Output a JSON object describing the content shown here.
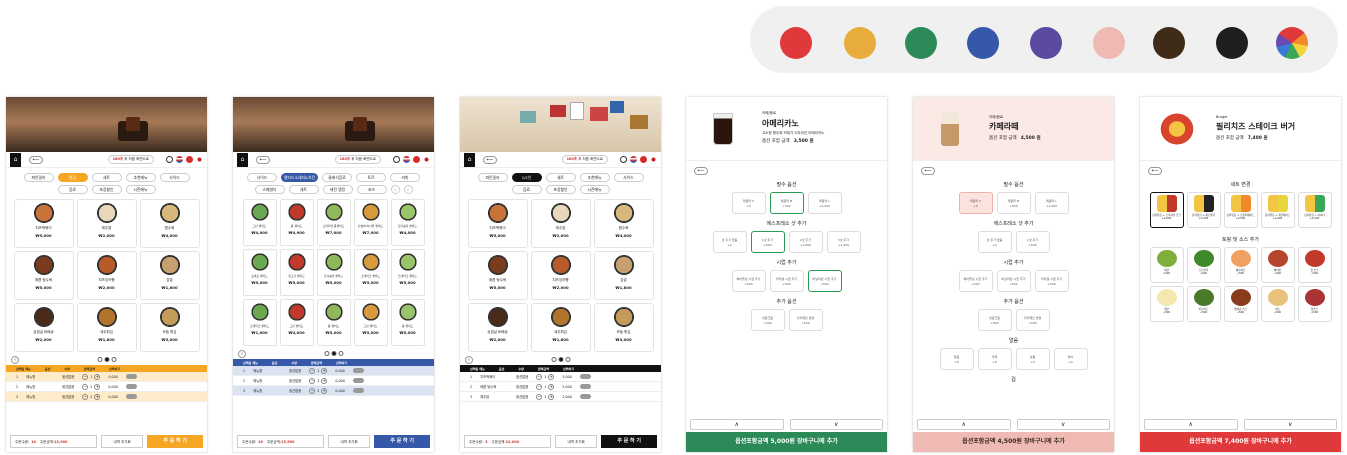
{
  "palette": [
    {
      "name": "red",
      "color": "#e0393b"
    },
    {
      "name": "yellow",
      "color": "#e8ad3c"
    },
    {
      "name": "green",
      "color": "#2b8a57"
    },
    {
      "name": "blue",
      "color": "#3658a8"
    },
    {
      "name": "purple",
      "color": "#5b4aa0"
    },
    {
      "name": "pink",
      "color": "#efb9b4"
    },
    {
      "name": "brown",
      "color": "#3f2c18"
    },
    {
      "name": "black",
      "color": "#1f1f1f"
    },
    {
      "name": "rainbow",
      "color": "multi"
    }
  ],
  "timer": {
    "num": "180초",
    "text": " 후 처음 화면으로"
  },
  "home_icon": "⌂",
  "back_label": "⟵",
  "panel1": {
    "accent": "#f5a623",
    "tabs": [
      "파인밀러",
      "면공",
      "세트",
      "추천메뉴",
      "사이드",
      "음료",
      "포장할인",
      "시즌메뉴"
    ],
    "active_tab": 1,
    "dishes": [
      {
        "name": "치즈떡볶이",
        "price": "₩5,000"
      },
      {
        "name": "제주쌈",
        "price": "₩2,000"
      },
      {
        "name": "짬수육",
        "price": "₩4,000"
      },
      {
        "name": "매콤 탕수육",
        "price": "₩5,000"
      },
      {
        "name": "치즈잉어빵",
        "price": "₩2,000"
      },
      {
        "name": "김밥",
        "price": "₩1,800"
      },
      {
        "name": "삼겹살 바베큐",
        "price": "₩2,000"
      },
      {
        "name": "새우튀김",
        "price": "₩1,800"
      },
      {
        "name": "모둠 튀김",
        "price": "₩3,000"
      }
    ],
    "order_head": [
      "선택된 메뉴",
      "옵션",
      "수량",
      "판매금액",
      "선택하기"
    ],
    "orders": [
      {
        "no": "1",
        "name": "매뉴명",
        "opt": "옵션없음",
        "qty": "1",
        "price": "0,000"
      },
      {
        "no": "2",
        "name": "매뉴명",
        "opt": "옵션없음",
        "qty": "2",
        "price": "0,000"
      },
      {
        "no": "3",
        "name": "매뉴명",
        "opt": "옵션없음",
        "qty": "2",
        "price": "0,000"
      }
    ],
    "count_label": "주문수량:",
    "count": "10",
    "amount_label": "주문금액:",
    "amount": "13,900",
    "reset": "내역 초기화",
    "order": "주 문 하 기"
  },
  "panel2": {
    "accent": "#3658a8",
    "tabs": [
      "사이드",
      "멜티드소세지&치킨",
      "클래식음료",
      "토르",
      "커피",
      "스페셜티",
      "세트",
      "레전 랭킹",
      "코즈"
    ],
    "active_tab": 1,
    "dishes": [
      {
        "name": "그린 샐러드",
        "price": "₩4,000"
      },
      {
        "name": "콥 샐러드",
        "price": "₩4,900"
      },
      {
        "name": "오리지널 콥샐러드",
        "price": "₩7,000"
      },
      {
        "name": "단호박 어니언 샐러드",
        "price": "₩7,000"
      },
      {
        "name": "닭가슴살 샐러드",
        "price": "₩4,000"
      },
      {
        "name": "토마토 샐러드",
        "price": "₩5,000"
      },
      {
        "name": "불고기 샐러드",
        "price": "₩5,000"
      },
      {
        "name": "닭가슴살 샐러드",
        "price": "₩5,000"
      },
      {
        "name": "스테이크 샐러드",
        "price": "₩5,000"
      },
      {
        "name": "스테이크 샐러드",
        "price": "₩5,000"
      },
      {
        "name": "스테이크 샐러드",
        "price": "₩1,000"
      },
      {
        "name": "그린 샐러드",
        "price": "₩4,000"
      },
      {
        "name": "콥 샐러드",
        "price": "₩5,000"
      },
      {
        "name": "그린 샐러드",
        "price": "₩5,000"
      },
      {
        "name": "콥 샐러드",
        "price": "₩5,000"
      }
    ],
    "orders": [
      {
        "no": "1",
        "name": "매뉴명",
        "opt": "옵션없음",
        "qty": "1",
        "price": "0,000"
      },
      {
        "no": "2",
        "name": "매뉴명",
        "opt": "옵션없음",
        "qty": "2",
        "price": "0,000"
      },
      {
        "no": "3",
        "name": "매뉴명",
        "opt": "옵션없음",
        "qty": "2",
        "price": "0,000"
      }
    ],
    "count": "10",
    "amount": "13,900",
    "reset": "내역 초기화",
    "order": "주 문 하 기"
  },
  "panel3": {
    "accent": "#111111",
    "tabs": [
      "파인밀러",
      "1/2인",
      "세트",
      "추천메뉴",
      "사이드",
      "음료",
      "포장할인",
      "시즌메뉴"
    ],
    "active_tab": 1,
    "dishes": [
      {
        "name": "치즈떡볶이",
        "price": "₩5,000"
      },
      {
        "name": "제주쌈",
        "price": "₩2,000"
      },
      {
        "name": "짬수육",
        "price": "₩4,000"
      },
      {
        "name": "매콤 탕수육",
        "price": "₩5,000"
      },
      {
        "name": "치즈잉어빵",
        "price": "₩2,000"
      },
      {
        "name": "김밥",
        "price": "₩1,800"
      },
      {
        "name": "삼겹살 바베큐",
        "price": "₩2,000"
      },
      {
        "name": "새우튀김",
        "price": "₩1,800"
      },
      {
        "name": "모둠 튀김",
        "price": "₩3,000"
      }
    ],
    "orders": [
      {
        "no": "1",
        "name": "치즈떡볶이",
        "opt": "옵션없음",
        "qty": "1",
        "price": "5,000"
      },
      {
        "no": "2",
        "name": "매콤 탕수육",
        "opt": "옵션없음",
        "qty": "1",
        "price": "5,000"
      },
      {
        "no": "3",
        "name": "제주쌈",
        "opt": "옵션없음",
        "qty": "1",
        "price": "2,000"
      }
    ],
    "count": "3",
    "amount": "12,000",
    "reset": "내역 초기화",
    "order": "주 문 하 기"
  },
  "panel4": {
    "category": "카페/음료",
    "title": "아메리카노",
    "desc": "고소한 원두와 커피가 어우러진 아메리카노",
    "total_label": "옵션 포함 금액",
    "total": "3,500 원",
    "sections": [
      {
        "title": "필수 옵션",
        "opts": [
          {
            "n": "레귤러 S",
            "p": "+0"
          },
          {
            "n": "레귤러 M",
            "p": "+500"
          },
          {
            "n": "레귤러 L",
            "p": "+1,000"
          }
        ],
        "sel": 1
      },
      {
        "title": "에스프레소 샷 추가",
        "opts": [
          {
            "n": "샷 추가 없음",
            "p": "+0"
          },
          {
            "n": "1샷 추가",
            "p": "+500"
          },
          {
            "n": "2샷 추가",
            "p": "+1,000"
          },
          {
            "n": "3샷 추가",
            "p": "+1,500"
          }
        ],
        "sel": 1
      },
      {
        "title": "시럽 추가",
        "opts": [
          {
            "n": "헤이즐넛 시럽 추가",
            "p": "+500"
          },
          {
            "n": "카라멜 시럽 추가",
            "p": "+500"
          },
          {
            "n": "바닐라빈 시럽 추가",
            "p": "+500"
          }
        ],
        "sel": 2
      },
      {
        "title": "추가 옵션",
        "opts": [
          {
            "n": "휘핑크림",
            "p": "+500"
          },
          {
            "n": "디카페인 변경",
            "p": "+500"
          }
        ],
        "sel": -1
      }
    ],
    "up": "∧",
    "down": "∨",
    "cta": "옵션포함금액 5,000원   장바구니에 추가",
    "color": "#2b8a57"
  },
  "panel5": {
    "category": "카페/음료",
    "title": "카페라떼",
    "total_label": "옵션 포함 금액",
    "total": "4,500 원",
    "sections": [
      {
        "title": "필수 옵션",
        "opts": [
          {
            "n": "레귤러 S",
            "p": "+0"
          },
          {
            "n": "레귤러 M",
            "p": "+500"
          },
          {
            "n": "레귤러 L",
            "p": "+1,000"
          }
        ],
        "sel": 0
      },
      {
        "title": "에스프레소 샷 추가",
        "opts": [
          {
            "n": "샷 추가 없음",
            "p": "+0"
          },
          {
            "n": "1샷 추가",
            "p": "+500"
          }
        ],
        "sel": -1
      },
      {
        "title": "시럽 추가",
        "opts": [
          {
            "n": "헤이즐넛 시럽 추가",
            "p": "+500"
          },
          {
            "n": "바닐라빈 시럽 추가",
            "p": "+500"
          },
          {
            "n": "카라멜 시럽 추가",
            "p": "+500"
          }
        ],
        "sel": -1
      },
      {
        "title": "추가 옵션",
        "opts": [
          {
            "n": "휘핑크림",
            "p": "+500"
          },
          {
            "n": "디카페인 변경",
            "p": "+500"
          }
        ],
        "sel": -1
      },
      {
        "title": "얼음",
        "opts": [
          {
            "n": "없음",
            "p": "+0"
          },
          {
            "n": "적게",
            "p": "+0"
          },
          {
            "n": "보통",
            "p": "+0"
          },
          {
            "n": "많이",
            "p": "+0"
          }
        ],
        "sel": -1
      },
      {
        "title": "컵",
        "opts": [],
        "sel": -1
      }
    ],
    "up": "∧",
    "down": "∨",
    "cta": "옵션포함금액 4,500원   장바구니에 추가",
    "color": "#efb9b4"
  },
  "panel6": {
    "category": "Burger",
    "title": "필리치즈 스테이크 버거",
    "total_label": "옵션 포함 금액",
    "total": "7,400 원",
    "set_title": "세트 변경",
    "sets": [
      {
        "n": "감자튀김 + 오리지널 코크",
        "p": "+2,000"
      },
      {
        "n": "감자튀김 + 제로콜라",
        "p": "+2,000"
      },
      {
        "n": "감자튀김 + 오렌지에이드",
        "p": "+2,000"
      },
      {
        "n": "감자튀김 + 레몬에이드",
        "p": "+2,000"
      },
      {
        "n": "감자튀김 + 사이다",
        "p": "+2,000"
      }
    ],
    "topping_title": "토핑 및 소스 추가",
    "toppings": [
      {
        "n": "피클",
        "p": "+500"
      },
      {
        "n": "브로콜리",
        "p": "+500"
      },
      {
        "n": "체다치즈",
        "p": "+500"
      },
      {
        "n": "베이컨",
        "p": "+500"
      },
      {
        "n": "핫 소스",
        "p": "+500"
      },
      {
        "n": "계란",
        "p": "+500"
      },
      {
        "n": "아보카도",
        "p": "+500"
      },
      {
        "n": "바베큐 소스",
        "p": "+500"
      },
      {
        "n": "치즈",
        "p": "+500"
      },
      {
        "n": "핫소스",
        "p": "+500"
      }
    ],
    "up": "∧",
    "down": "∨",
    "cta": "옵션포함금액 7,400원   장바구니에 추가",
    "color": "#e0393b"
  }
}
